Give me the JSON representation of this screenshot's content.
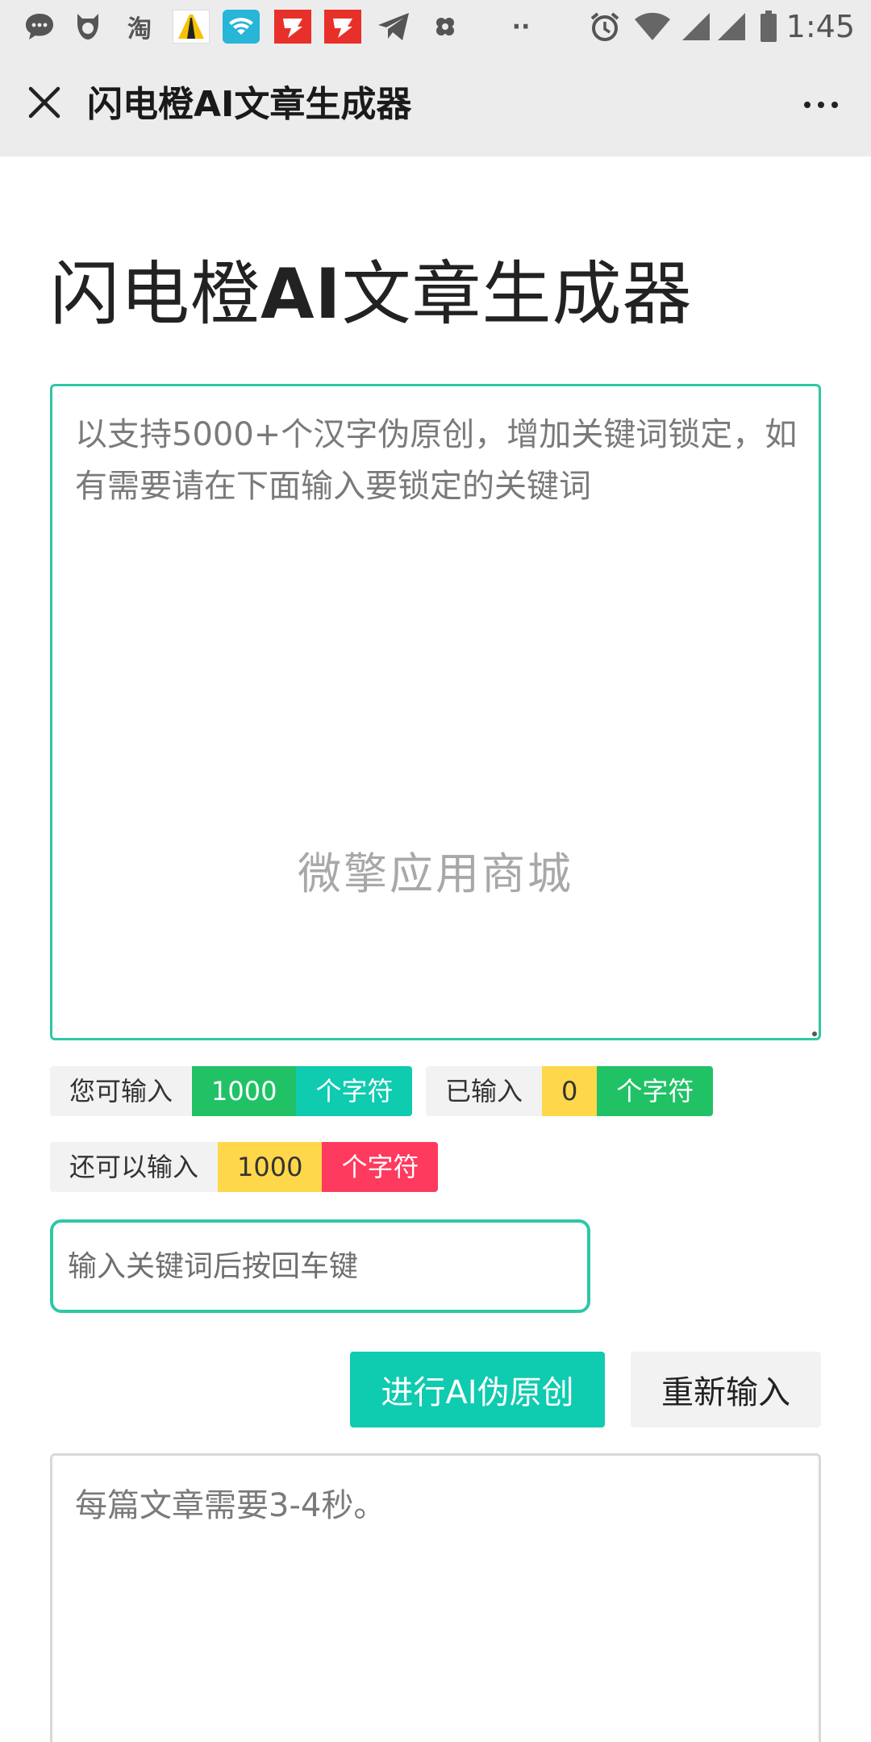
{
  "status_bar": {
    "time": "1:45",
    "icons": [
      "message-icon",
      "bird-icon",
      "taobao-icon",
      "road-icon",
      "wifi-app-icon",
      "app-red-icon",
      "app-red-icon",
      "telegram-icon",
      "flower-icon",
      "dots-icon",
      "alarm-icon",
      "wifi-icon",
      "signal-icon",
      "signal-icon",
      "battery-icon"
    ],
    "taobao_text": "淘",
    "more_text": "··"
  },
  "app_bar": {
    "title": "闪电橙AI文章生成器"
  },
  "page": {
    "title_part1": "闪电橙",
    "title_part2": "AI",
    "title_part3": "文章生成器"
  },
  "main_textarea": {
    "placeholder": "以支持5000+个汉字伪原创，增加关键词锁定，如有需要请在下面输入要锁定的关键词",
    "watermark": "微擎应用商城"
  },
  "counters": {
    "can_input_label": "您可输入",
    "can_input_value": "1000",
    "char_unit": "个字符",
    "entered_label": "已输入",
    "entered_value": "0",
    "remaining_label": "还可以输入",
    "remaining_value": "1000"
  },
  "keyword_input": {
    "placeholder": "输入关键词后按回车键"
  },
  "buttons": {
    "rewrite": "进行AI伪原创",
    "reset": "重新输入"
  },
  "result_textarea": {
    "placeholder": "每篇文章需要3-4秒。"
  },
  "colors": {
    "accent": "#0fcbb0",
    "border_accent": "#2fc7a5",
    "green": "#21c266",
    "yellow": "#fed74b",
    "red": "#ff3a5f"
  }
}
